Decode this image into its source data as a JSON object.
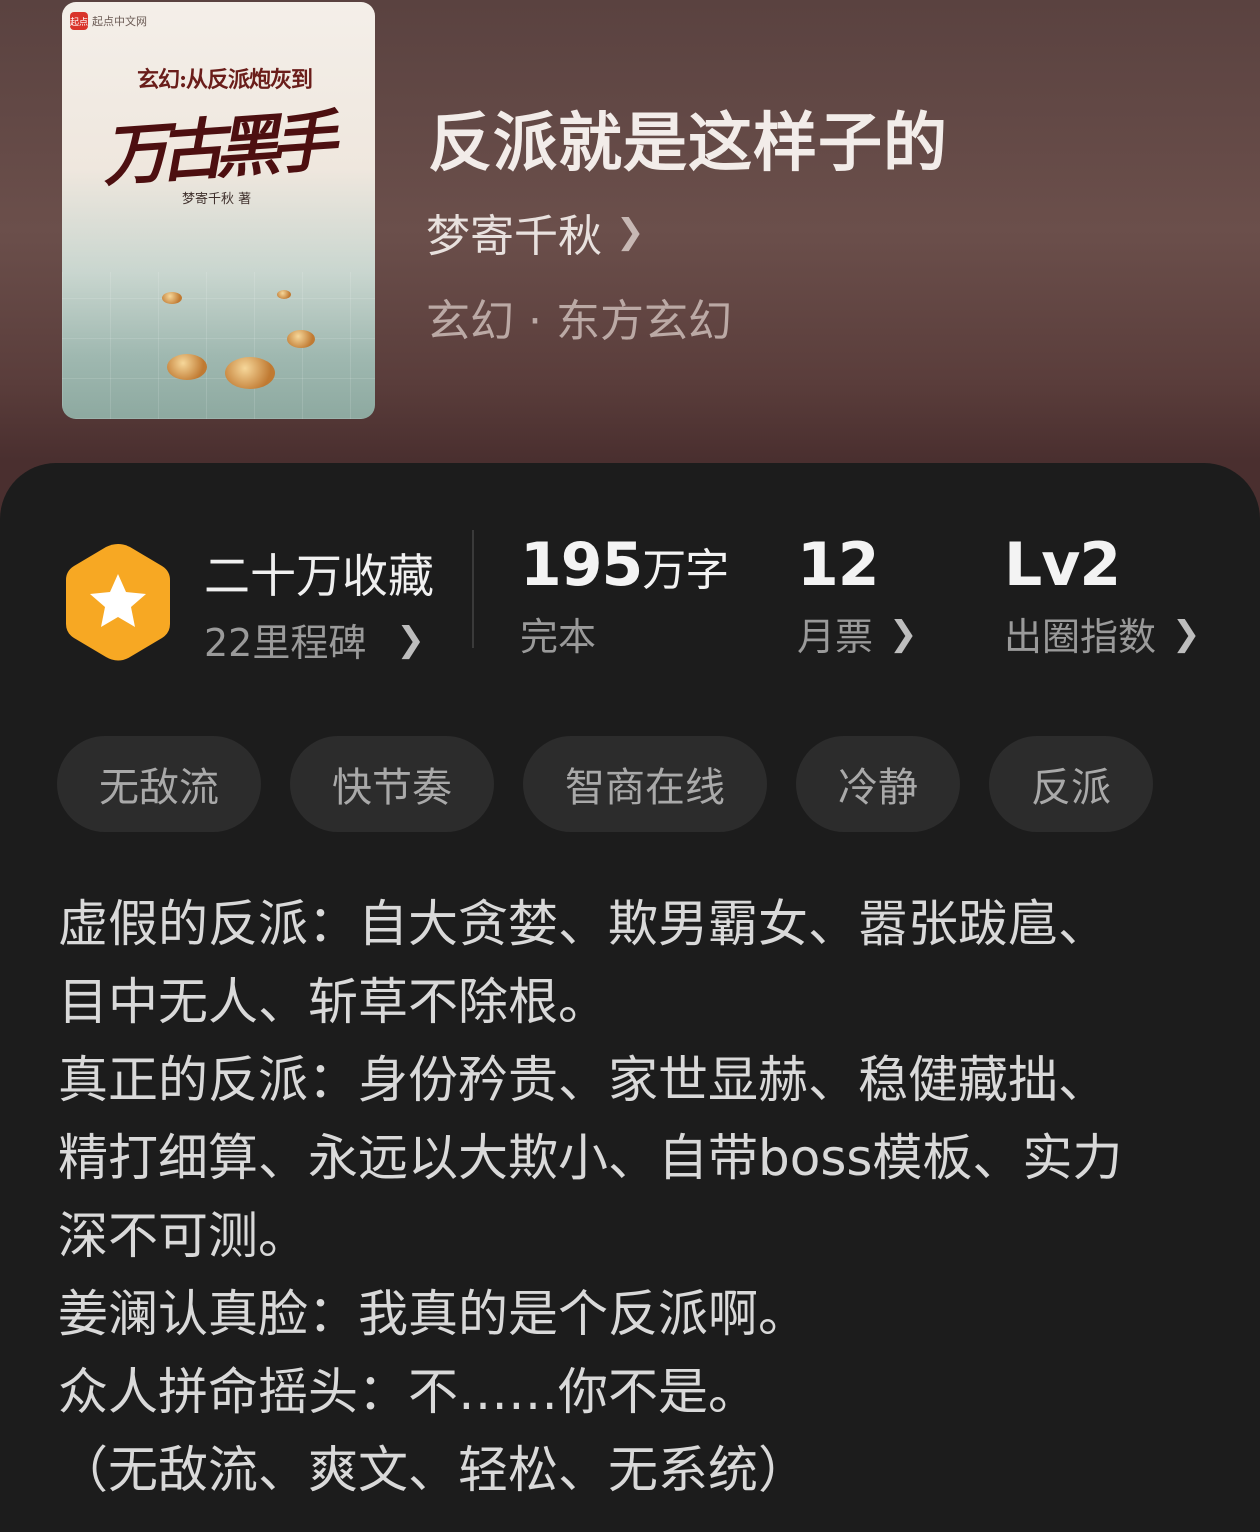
{
  "cover": {
    "brand": "起点中文网",
    "brand_logo": "起点",
    "subtitle": "玄幻:从反派炮灰到",
    "main_title": "万古黑手",
    "author": "梦寄千秋 著"
  },
  "book": {
    "title": "反派就是这样子的",
    "author": "梦寄千秋",
    "genre": "玄幻 · 东方玄幻"
  },
  "stats": {
    "collect_title": "二十万收藏",
    "milestone": "22里程碑",
    "words_num": "195",
    "words_unit": "万字",
    "words_label": "完本",
    "monthly_num": "12",
    "monthly_label": "月票",
    "index_num": "Lv2",
    "index_label": "出圈指数"
  },
  "tags": [
    "无敌流",
    "快节奏",
    "智商在线",
    "冷静",
    "反派"
  ],
  "description": [
    "虚假的反派：自大贪婪、欺男霸女、嚣张跋扈、",
    "目中无人、斩草不除根。",
    "真正的反派：身份矜贵、家世显赫、稳健藏拙、",
    "精打细算、永远以大欺小、自带boss模板、实力",
    "深不可测。",
    "姜澜认真脸：我真的是个反派啊。",
    "众人拼命摇头：不……你不是。",
    "（无敌流、爽文、轻松、无系统）"
  ],
  "colors": {
    "badge": "#f7a823",
    "panel": "#1c1c1c",
    "tag_bg": "#2c2c2c"
  }
}
